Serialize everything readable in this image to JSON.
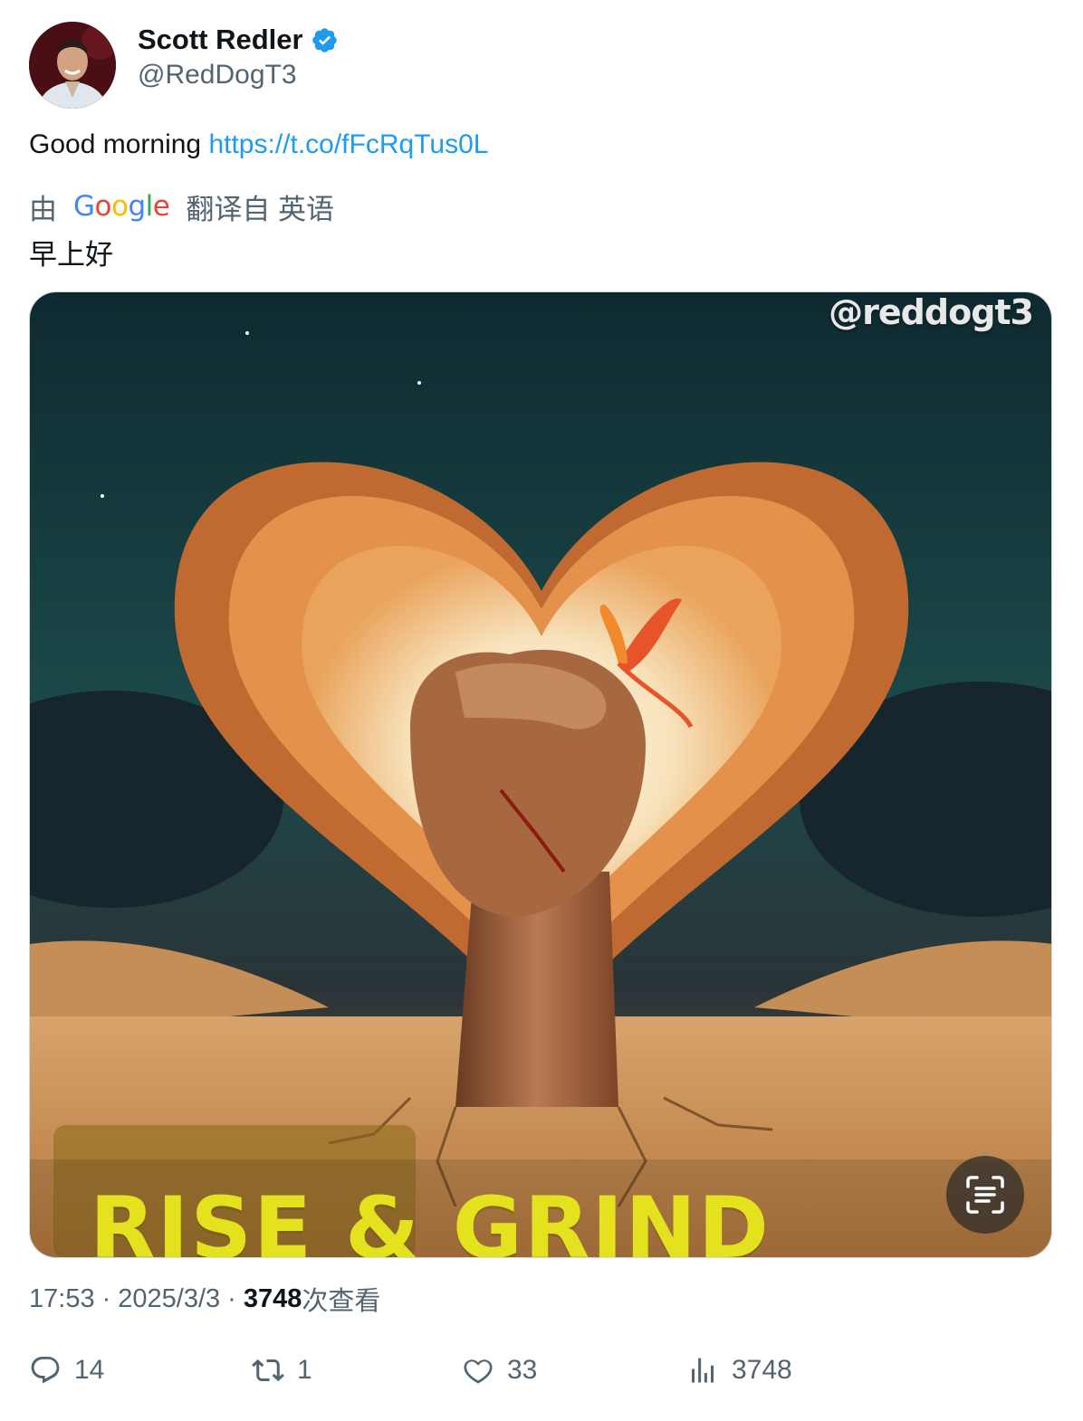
{
  "author": {
    "name": "Scott Redler",
    "handle": "@RedDogT3"
  },
  "tweet": {
    "text": "Good morning",
    "link": "https://t.co/fFcRqTus0L"
  },
  "translation": {
    "prefix": "由",
    "google_letters": [
      "G",
      "o",
      "o",
      "g",
      "l",
      "e"
    ],
    "suffix": "翻译自 英语",
    "text": "早上好"
  },
  "media": {
    "watermark": "@reddogt3",
    "slogan": "RISE & GRIND"
  },
  "meta": {
    "time": "17:53",
    "date": "2025/3/3",
    "sep": "·",
    "views_count": "3748",
    "views_label": "次查看"
  },
  "actions": {
    "replies": "14",
    "retweets": "1",
    "likes": "33",
    "views": "3748"
  },
  "colors": {
    "link": "#1d9bf0",
    "verified": "#1d9bf0",
    "secondary_text": "#536471",
    "slogan": "#e4e21e"
  }
}
